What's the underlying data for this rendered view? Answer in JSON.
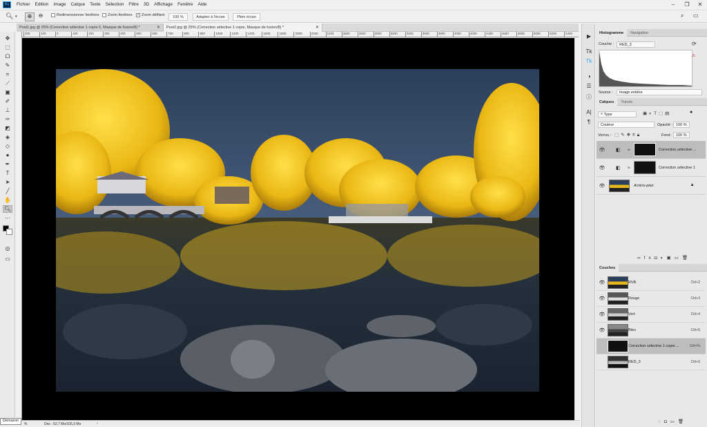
{
  "menu": {
    "items": [
      "Fichier",
      "Edition",
      "Image",
      "Calque",
      "Texte",
      "Sélection",
      "Filtre",
      "3D",
      "Affichage",
      "Fenêtre",
      "Aide"
    ]
  },
  "options": {
    "resize_windows": "Redimensionner fenêtres",
    "zoom_windows": "Zoom fenêtres",
    "scrubby_zoom": "Zoom défilant",
    "zoom_value": "100 %",
    "fit_screen": "Adapter à l'écran",
    "fill_screen": "Plein écran"
  },
  "tabs": [
    {
      "label": "Post1.jpg @ 25% (Correction sélective 1 copie 5, Masque de fusion/8) *"
    },
    {
      "label": "Post2.jpg @ 25% (Correction sélective 1 copie, Masque de fusion/8) *"
    }
  ],
  "ruler_ticks": [
    "200",
    "100",
    "0",
    "100",
    "200",
    "300",
    "400",
    "500",
    "600",
    "700",
    "800",
    "900",
    "1000",
    "1200",
    "1400",
    "1600",
    "1800",
    "2000",
    "2200",
    "2400",
    "2600",
    "2800",
    "3000",
    "3200",
    "3400",
    "3600",
    "3800",
    "4000",
    "4200",
    "4400",
    "4600",
    "4800",
    "5000",
    "5200",
    "5400"
  ],
  "status": {
    "tooltip": "Démarrer",
    "zoom": "%",
    "doc": "Doc : 52,7 Mo/105,3 Mo"
  },
  "histogram": {
    "tab_active": "Histogramme",
    "tab_other": "Navigation",
    "channel_label": "Couche :",
    "channel_value": "RED_3",
    "source_label": "Source :",
    "source_value": "Image entière"
  },
  "layers_panel": {
    "tab_active": "Calques",
    "tab_other": "Tracés",
    "filter_value": "Type",
    "blend_mode": "Couleur",
    "opacity_label": "Opacité :",
    "opacity_value": "100 %",
    "lock_label": "Verrou :",
    "fill_label": "Fond :",
    "fill_value": "100 %",
    "layers": [
      {
        "name": "Correction sélective ...",
        "selected": true
      },
      {
        "name": "Correction sélective 1",
        "selected": false
      },
      {
        "name": "Arrière-plan",
        "selected": false
      }
    ]
  },
  "channels_panel": {
    "title": "Couches",
    "channels": [
      {
        "name": "RVB",
        "key": "Ctrl+2",
        "selected": false
      },
      {
        "name": "Rouge",
        "key": "Ctrl+3",
        "selected": false
      },
      {
        "name": "Vert",
        "key": "Ctrl+4",
        "selected": false
      },
      {
        "name": "Bleu",
        "key": "Ctrl+5",
        "selected": false
      },
      {
        "name": "Correction sélective 1 copie ...",
        "key": "Ctrl+%",
        "selected": true
      },
      {
        "name": "RED_3",
        "key": "Ctrl+6",
        "selected": false
      }
    ]
  },
  "colors": {
    "accent": "#31a8ff",
    "selected_row": "#bdbdbd",
    "foliage": "#f3c41a",
    "sky": "#283c5a"
  }
}
